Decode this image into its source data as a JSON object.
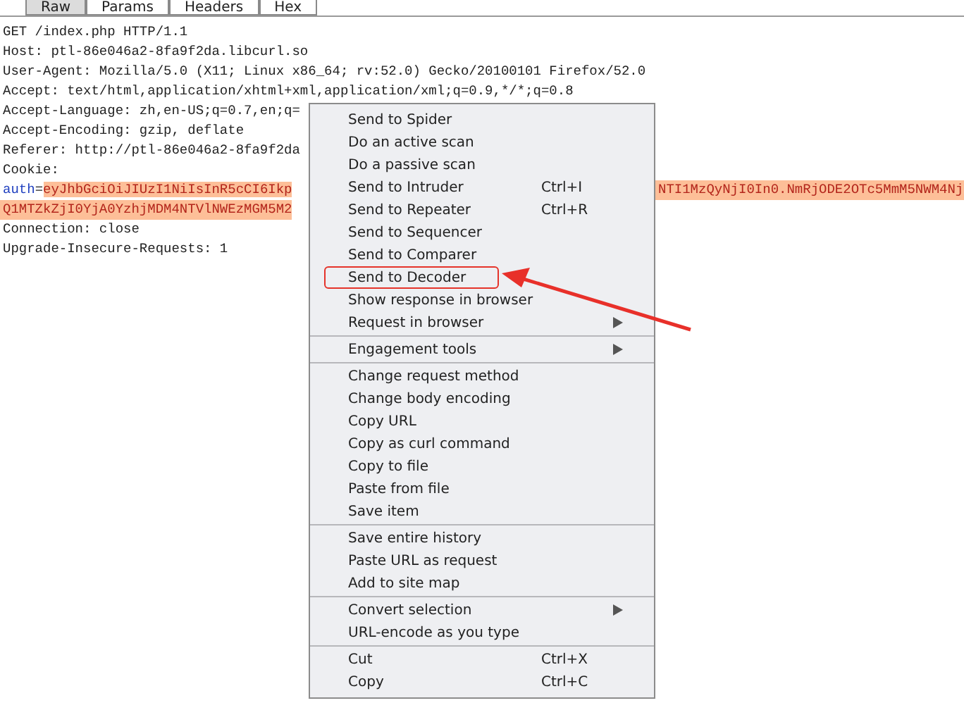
{
  "tabs": [
    {
      "label": "Raw",
      "selected": true
    },
    {
      "label": "Params",
      "selected": false
    },
    {
      "label": "Headers",
      "selected": false
    },
    {
      "label": "Hex",
      "selected": false
    }
  ],
  "request_lines": [
    {
      "kind": "plain",
      "text": "GET /index.php HTTP/1.1"
    },
    {
      "kind": "plain",
      "text": "Host: ptl-86e046a2-8fa9f2da.libcurl.so"
    },
    {
      "kind": "plain",
      "text": "User-Agent: Mozilla/5.0 (X11; Linux x86_64; rv:52.0) Gecko/20100101 Firefox/52.0"
    },
    {
      "kind": "plain",
      "text": "Accept: text/html,application/xhtml+xml,application/xml;q=0.9,*/*;q=0.8"
    },
    {
      "kind": "plain",
      "text": "Accept-Language: zh,en-US;q=0.7,en;q="
    },
    {
      "kind": "plain",
      "text": "Accept-Encoding: gzip, deflate"
    },
    {
      "kind": "plain",
      "text": "Referer: http://ptl-86e046a2-8fa9f2da"
    },
    {
      "kind": "plain",
      "text": "Cookie:"
    },
    {
      "kind": "param",
      "name": "auth",
      "sep": "=",
      "text": "eyJhbGciOiJIUzI1NiIsInR5cCI6Ikp",
      "right": "NTI1MzQyNjI0In0.NmRjODE2OTc5MmM5NWM4Nj"
    },
    {
      "kind": "highlight",
      "text": "Q1MTZkZjI0YjA0YzhjMDM4NTVlNWEzMGM5M2"
    },
    {
      "kind": "plain",
      "text": "Connection: close"
    },
    {
      "kind": "plain",
      "text": "Upgrade-Insecure-Requests: 1"
    }
  ],
  "context_menu": [
    {
      "kind": "item",
      "label": "Send to Spider",
      "has_submenu": false,
      "outlined": false
    },
    {
      "kind": "item",
      "label": "Do an active scan",
      "has_submenu": false,
      "outlined": false
    },
    {
      "kind": "item",
      "label": "Do a passive scan",
      "has_submenu": false,
      "outlined": false
    },
    {
      "kind": "item",
      "label": "Send to Intruder",
      "shortcut": "Ctrl+I",
      "has_submenu": false,
      "outlined": false
    },
    {
      "kind": "item",
      "label": "Send to Repeater",
      "shortcut": "Ctrl+R",
      "has_submenu": false,
      "outlined": false
    },
    {
      "kind": "item",
      "label": "Send to Sequencer",
      "has_submenu": false,
      "outlined": false
    },
    {
      "kind": "item",
      "label": "Send to Comparer",
      "has_submenu": false,
      "outlined": false
    },
    {
      "kind": "item",
      "label": "Send to Decoder",
      "has_submenu": false,
      "outlined": true
    },
    {
      "kind": "item",
      "label": "Show response in browser",
      "has_submenu": false,
      "outlined": false
    },
    {
      "kind": "item",
      "label": "Request in browser",
      "has_submenu": true,
      "outlined": false
    },
    {
      "kind": "separator"
    },
    {
      "kind": "item",
      "label": "Engagement tools",
      "has_submenu": true,
      "outlined": false
    },
    {
      "kind": "separator"
    },
    {
      "kind": "item",
      "label": "Change request method",
      "has_submenu": false,
      "outlined": false
    },
    {
      "kind": "item",
      "label": "Change body encoding",
      "has_submenu": false,
      "outlined": false
    },
    {
      "kind": "item",
      "label": "Copy URL",
      "has_submenu": false,
      "outlined": false
    },
    {
      "kind": "item",
      "label": "Copy as curl command",
      "has_submenu": false,
      "outlined": false
    },
    {
      "kind": "item",
      "label": "Copy to file",
      "has_submenu": false,
      "outlined": false
    },
    {
      "kind": "item",
      "label": "Paste from file",
      "has_submenu": false,
      "outlined": false
    },
    {
      "kind": "item",
      "label": "Save item",
      "has_submenu": false,
      "outlined": false
    },
    {
      "kind": "separator"
    },
    {
      "kind": "item",
      "label": "Save entire history",
      "has_submenu": false,
      "outlined": false
    },
    {
      "kind": "item",
      "label": "Paste URL as request",
      "has_submenu": false,
      "outlined": false
    },
    {
      "kind": "item",
      "label": "Add to site map",
      "has_submenu": false,
      "outlined": false
    },
    {
      "kind": "separator"
    },
    {
      "kind": "item",
      "label": "Convert selection",
      "has_submenu": true,
      "outlined": false
    },
    {
      "kind": "item",
      "label": "URL-encode as you type",
      "has_submenu": false,
      "outlined": false
    },
    {
      "kind": "separator"
    },
    {
      "kind": "item",
      "label": "Cut",
      "shortcut": "Ctrl+X",
      "has_submenu": false,
      "outlined": false
    },
    {
      "kind": "item",
      "label": "Copy",
      "shortcut": "Ctrl+C",
      "has_submenu": false,
      "outlined": false
    }
  ]
}
